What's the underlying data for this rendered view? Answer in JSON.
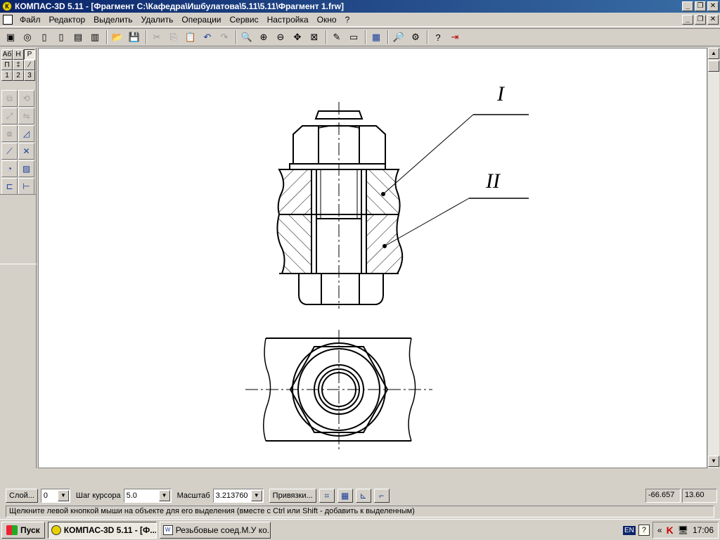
{
  "window": {
    "title": "КОМПАС-3D 5.11 - [Фрагмент C:\\Кафедра\\Ишбулатова\\5.11\\5.11\\Фрагмент 1.frw]",
    "app_icon_glyph": "К",
    "min_glyph": "_",
    "max_glyph": "❐",
    "close_glyph": "✕"
  },
  "menu": {
    "items": [
      "Файл",
      "Редактор",
      "Выделить",
      "Удалить",
      "Операции",
      "Сервис",
      "Настройка",
      "Окно",
      "?"
    ]
  },
  "mode_panel": {
    "buttons": [
      "Аб",
      "Н",
      "Р",
      "П",
      "‡",
      "⁄",
      "1",
      "2",
      "3"
    ]
  },
  "drawing": {
    "label_part1": "I",
    "label_part2": "II"
  },
  "status": {
    "layer_button": "Слой...",
    "layer_value": "0",
    "cursor_step_label": "Шаг курсора",
    "cursor_step_value": "5.0",
    "scale_label": "Масштаб",
    "scale_value": "3.213760",
    "snaps_button": "Привязки...",
    "coord_x": "-66.657",
    "coord_y": "13.60",
    "hint": "Щелкните левой кнопкой мыши на объекте для его выделения (вместе с Ctrl или Shift - добавить к выделенным)"
  },
  "taskbar": {
    "start_label": "Пуск",
    "tasks": [
      {
        "label": "КОМПАС-3D 5.11 - [Ф...",
        "active": true
      },
      {
        "label": "Резьбовые соед.М.У ко...",
        "active": false
      }
    ],
    "lang": "EN",
    "clock": "17:06"
  },
  "colors": {
    "titlebar_start": "#0a246a",
    "titlebar_end": "#3a6ea5",
    "face": "#d4d0c8"
  }
}
